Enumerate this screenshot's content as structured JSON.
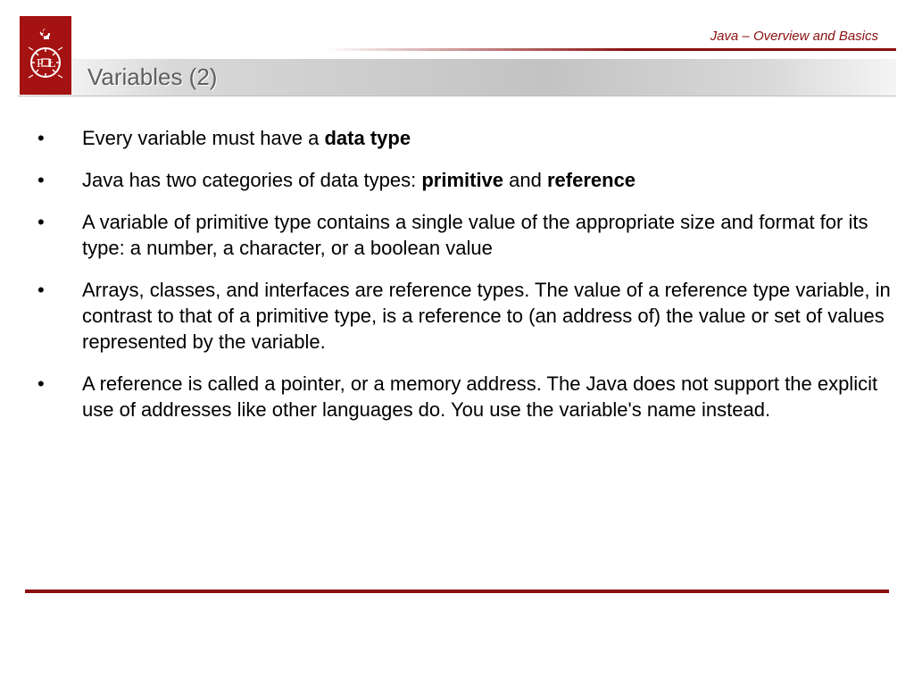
{
  "header": {
    "subtitle": "Java – Overview and Basics",
    "title": "Variables (2)"
  },
  "bullets": [
    {
      "runs": [
        {
          "t": "Every variable must have a "
        },
        {
          "t": "data type",
          "bold": true
        }
      ]
    },
    {
      "runs": [
        {
          "t": "Java has two categories of data types: "
        },
        {
          "t": "primitive",
          "bold": true
        },
        {
          "t": " and "
        },
        {
          "t": "reference",
          "bold": true
        }
      ]
    },
    {
      "runs": [
        {
          "t": "A variable of primitive type contains a single value of the appropriate size and format for its type: a number, a character, or a boolean value"
        }
      ]
    },
    {
      "runs": [
        {
          "t": "Arrays, classes, and interfaces are reference types. The value of a reference type variable, in contrast to that of a primitive type, is a reference to (an address of) the value or set of values represented by the variable."
        }
      ]
    },
    {
      "runs": [
        {
          "t": "A reference is called a pointer, or a memory address. The Java does not support the explicit use of addresses like other languages do. You use the variable's name instead."
        }
      ]
    }
  ]
}
